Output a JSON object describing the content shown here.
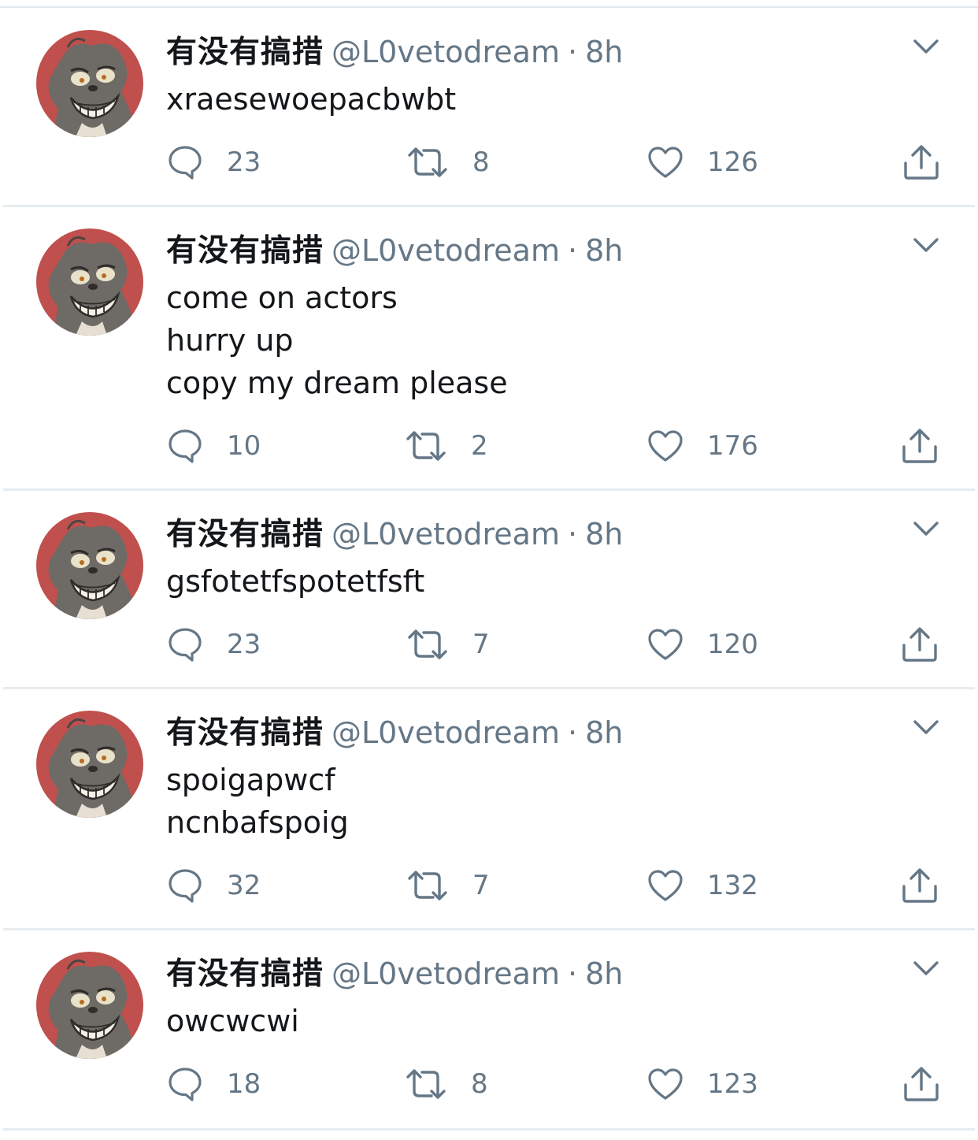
{
  "colors": {
    "primary_text": "#14171a",
    "secondary_text": "#657786",
    "divider": "#e6ecf0",
    "avatar_bg": "#c0504d"
  },
  "icons": {
    "reply": "speech-bubble-icon",
    "retweet": "retweet-arrows-icon",
    "like": "heart-icon",
    "share": "share-upload-icon",
    "more": "chevron-down-icon"
  },
  "tweets": [
    {
      "display_name": "有没有搞措",
      "handle": "@L0vetodream",
      "separator": "·",
      "time": "8h",
      "lines": [
        "xraesewoepacbwbt"
      ],
      "replies": "23",
      "retweets": "8",
      "likes": "126"
    },
    {
      "display_name": "有没有搞措",
      "handle": "@L0vetodream",
      "separator": "·",
      "time": "8h",
      "lines": [
        "come on actors",
        "hurry up",
        "copy my dream please"
      ],
      "replies": "10",
      "retweets": "2",
      "likes": "176"
    },
    {
      "display_name": "有没有搞措",
      "handle": "@L0vetodream",
      "separator": "·",
      "time": "8h",
      "lines": [
        "gsfotetfspotetfsft"
      ],
      "replies": "23",
      "retweets": "7",
      "likes": "120"
    },
    {
      "display_name": "有没有搞措",
      "handle": "@L0vetodream",
      "separator": "·",
      "time": "8h",
      "lines": [
        "spoigapwcf",
        "ncnbafspoig"
      ],
      "replies": "32",
      "retweets": "7",
      "likes": "132"
    },
    {
      "display_name": "有没有搞措",
      "handle": "@L0vetodream",
      "separator": "·",
      "time": "8h",
      "lines": [
        "owcwcwi"
      ],
      "replies": "18",
      "retweets": "8",
      "likes": "123"
    }
  ]
}
